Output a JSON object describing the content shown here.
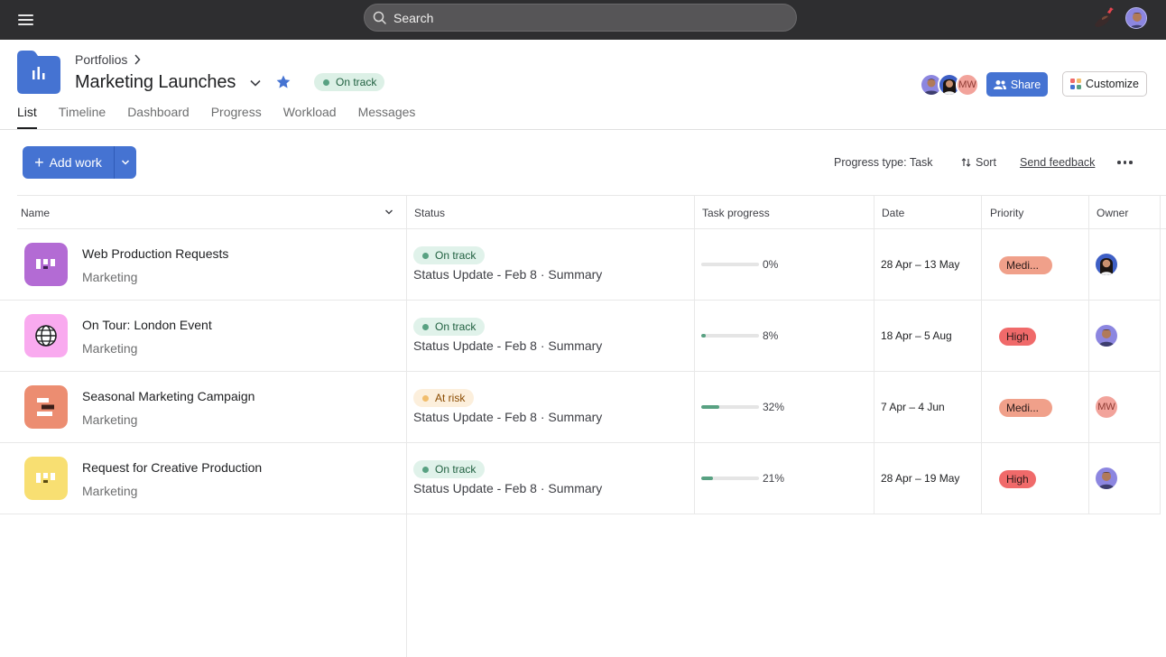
{
  "topbar": {
    "search_placeholder": "Search"
  },
  "header": {
    "breadcrumb": "Portfolios",
    "title": "Marketing Launches",
    "status": "On track",
    "member_initials": "MW",
    "share_label": "Share",
    "customize_label": "Customize"
  },
  "tabs": [
    {
      "label": "List",
      "active": true
    },
    {
      "label": "Timeline",
      "active": false
    },
    {
      "label": "Dashboard",
      "active": false
    },
    {
      "label": "Progress",
      "active": false
    },
    {
      "label": "Workload",
      "active": false
    },
    {
      "label": "Messages",
      "active": false
    }
  ],
  "toolbar": {
    "add_work_label": "Add work",
    "progress_type_label": "Progress type: Task",
    "sort_label": "Sort",
    "feedback_label": "Send feedback"
  },
  "columns": {
    "name": "Name",
    "status": "Status",
    "task_progress": "Task progress",
    "date": "Date",
    "priority": "Priority",
    "owner": "Owner"
  },
  "rows": [
    {
      "name": "Web Production Requests",
      "team": "Marketing",
      "icon_color": "#b36bd4",
      "icon": "board-icon",
      "status": "On track",
      "status_color": "#58a182",
      "update": "Status Update - Feb 8 · Summary",
      "progress_label": "0%",
      "progress": 0,
      "date": "28 Apr – 13 May",
      "priority": "Medi...",
      "priority_color": "#f0a08a",
      "owner": "avatar-woman"
    },
    {
      "name": "On Tour: London Event",
      "team": "Marketing",
      "icon_color": "#f9aaef",
      "icon": "globe-icon",
      "status": "On track",
      "status_color": "#58a182",
      "update": "Status Update - Feb 8 · Summary",
      "progress_label": "8%",
      "progress": 8,
      "date": "18 Apr – 5 Aug",
      "priority": "High",
      "priority_color": "#f06a6a",
      "owner": "avatar-man"
    },
    {
      "name": "Seasonal Marketing Campaign",
      "team": "Marketing",
      "icon_color": "#ec8d71",
      "icon": "timeline-icon",
      "status": "At risk",
      "status_color": "#f1bd6c",
      "update": "Status Update - Feb 8 · Summary",
      "progress_label": "32%",
      "progress": 32,
      "date": "7 Apr – 4 Jun",
      "priority": "Medi...",
      "priority_color": "#f0a08a",
      "owner": "MW"
    },
    {
      "name": "Request for Creative Production",
      "team": "Marketing",
      "icon_color": "#f8df72",
      "icon": "board-icon",
      "status": "On track",
      "status_color": "#58a182",
      "update": "Status Update - Feb 8 · Summary",
      "progress_label": "21%",
      "progress": 21,
      "date": "28 Apr – 19 May",
      "priority": "High",
      "priority_color": "#f06a6a",
      "owner": "avatar-man"
    }
  ]
}
